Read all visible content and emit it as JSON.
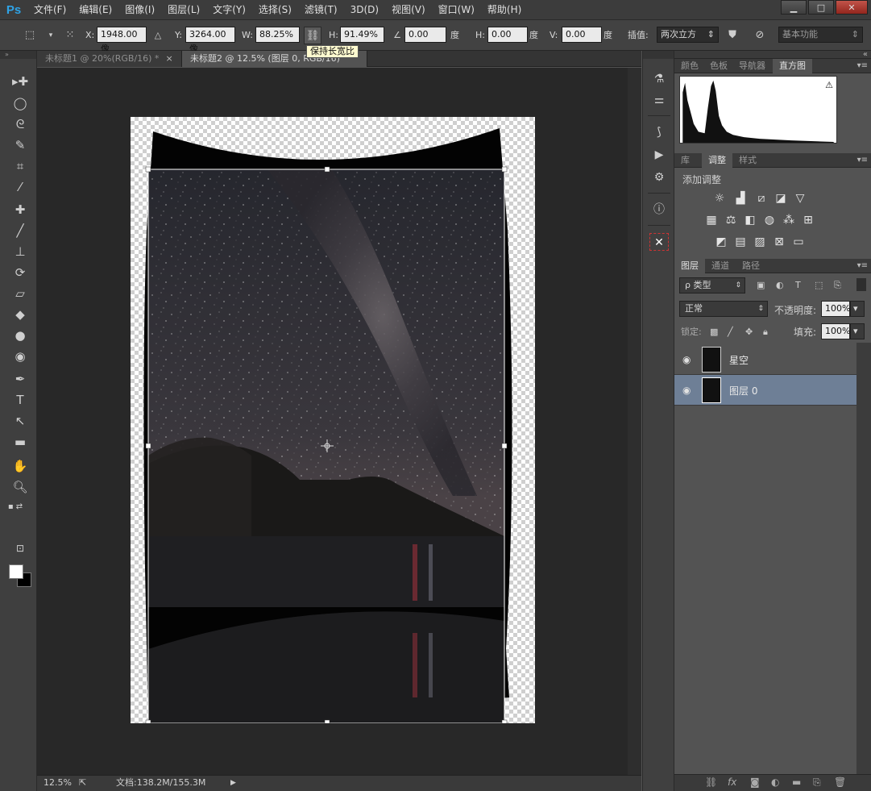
{
  "app": {
    "logo": "Ps"
  },
  "menu": [
    "文件(F)",
    "编辑(E)",
    "图像(I)",
    "图层(L)",
    "文字(Y)",
    "选择(S)",
    "滤镜(T)",
    "3D(D)",
    "视图(V)",
    "窗口(W)",
    "帮助(H)"
  ],
  "window_controls": {
    "minimize": "▁",
    "maximize": "□",
    "close": "✕"
  },
  "options": {
    "x_label": "X:",
    "x_value": "1948.00 像",
    "y_label": "Y:",
    "y_value": "3264.00 像",
    "w_label": "W:",
    "w_value": "88.25%",
    "h_label": "H:",
    "h_value": "91.49%",
    "angle_value": "0.00",
    "angle_unit": "度",
    "hskew_label": "H:",
    "hskew_value": "0.00",
    "hskew_unit": "度",
    "vskew_label": "V:",
    "vskew_value": "0.00",
    "vskew_unit": "度",
    "interp_label": "插值:",
    "interp_value": "两次立方",
    "workspace": "基本功能",
    "tooltip": "保持长宽比"
  },
  "tabs": [
    {
      "label": "未标题1 @ 20%(RGB/16) *",
      "close": "×"
    },
    {
      "label": "未标题2 @ 12.5% (图层 0, RGB/16)",
      "close": ""
    }
  ],
  "status": {
    "zoom": "12.5%",
    "doc": "文档:138.2M/155.3M"
  },
  "panels": {
    "top_tabs": [
      "颜色",
      "色板",
      "导航器",
      "直方图"
    ],
    "adj_tabs": [
      "库",
      "调整",
      "样式"
    ],
    "adj_title": "添加调整",
    "layers_tabs": [
      "图层",
      "通道",
      "路径"
    ],
    "layer_filter": "ρ 类型",
    "blend_mode": "正常",
    "opacity_label": "不透明度:",
    "opacity_value": "100%",
    "lock_label": "锁定:",
    "fill_label": "填充:",
    "fill_value": "100%",
    "layers": [
      {
        "name": "星空",
        "selected": false
      },
      {
        "name": "图层 0",
        "selected": true
      }
    ]
  }
}
